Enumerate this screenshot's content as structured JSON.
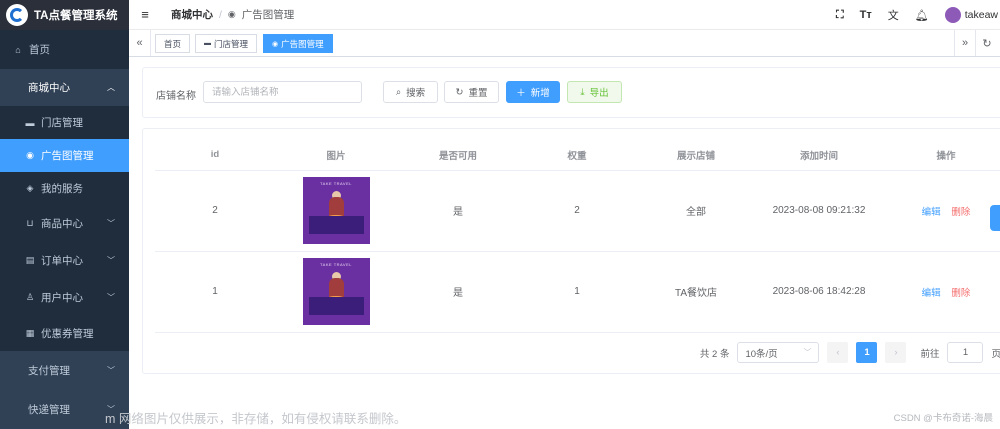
{
  "app": {
    "title": "TA点餐管理系统"
  },
  "sidebar": {
    "items": [
      {
        "label": "首页",
        "icon": "home-icon"
      },
      {
        "label": "商城中心",
        "icon": "",
        "expanded": true
      },
      {
        "label": "门店管理",
        "icon": "shop-icon"
      },
      {
        "label": "广告图管理",
        "icon": "camera-icon",
        "active": true
      },
      {
        "label": "我的服务",
        "icon": "service-icon"
      },
      {
        "label": "商品中心",
        "icon": "cart-icon"
      },
      {
        "label": "订单中心",
        "icon": "order-icon"
      },
      {
        "label": "用户中心",
        "icon": "user-icon"
      },
      {
        "label": "优惠券管理",
        "icon": "coupon-icon"
      },
      {
        "label": "支付管理",
        "icon": ""
      },
      {
        "label": "快递管理",
        "icon": ""
      }
    ]
  },
  "navbar": {
    "breadcrumb": [
      "商城中心",
      "广告图管理"
    ],
    "username": "takeaw"
  },
  "tags": [
    "首页",
    "门店管理",
    "广告图管理"
  ],
  "search": {
    "label": "店铺名称",
    "placeholder": "请输入店铺名称",
    "value": "",
    "search_btn": "搜索",
    "reset_btn": "重置",
    "add_btn": "新增",
    "export_btn": "导出"
  },
  "table": {
    "columns": [
      "id",
      "图片",
      "是否可用",
      "权重",
      "展示店铺",
      "添加时间",
      "操作"
    ],
    "image_text": "TAKE TRAVEL",
    "rows": [
      {
        "id": "2",
        "available": "是",
        "weight": "2",
        "shop": "全部",
        "time": "2023-08-08 09:21:32",
        "edit": "编辑",
        "delete": "删除"
      },
      {
        "id": "1",
        "available": "是",
        "weight": "1",
        "shop": "TA餐饮店",
        "time": "2023-08-06 18:42:28",
        "edit": "编辑",
        "delete": "删除"
      }
    ]
  },
  "pagination": {
    "total": "共 2 条",
    "page_size": "10条/页",
    "current": "1",
    "goto_label": "前往",
    "goto_value": "1",
    "page_suffix": "页"
  },
  "watermark": {
    "left": "m 网络图片仅供展示，非存储，如有侵权请联系删除。",
    "right": "CSDN @卡布奇诺-海晨"
  },
  "colors": {
    "primary": "#409eff",
    "sidebar": "#1f2d3d",
    "danger": "#f56c6c",
    "success": "#67c23a"
  }
}
